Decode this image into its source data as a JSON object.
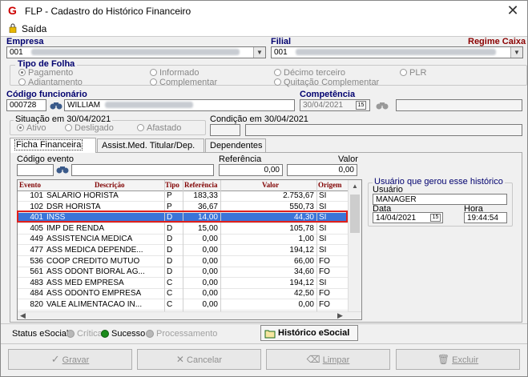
{
  "window": {
    "title": "FLP - Cadastro do Histórico Financeiro",
    "close_glyph": "✕"
  },
  "menu": {
    "saida": "Saída"
  },
  "empresa": {
    "label": "Empresa",
    "value": "001"
  },
  "filial": {
    "label": "Filial",
    "value": "001"
  },
  "regime": {
    "label": "Regime Caixa"
  },
  "tipo_folha": {
    "label": "Tipo de Folha",
    "options": [
      "Pagamento",
      "Informado",
      "Décimo terceiro",
      "PLR",
      "Adiantamento",
      "Complementar",
      "Quitação Complementar"
    ],
    "selected": "Pagamento"
  },
  "funcionario": {
    "label": "Código funcionário",
    "code": "000728",
    "name": "WILLIAM"
  },
  "competencia": {
    "label": "Competência",
    "value": "30/04/2021",
    "calendar_text": "15"
  },
  "situacao": {
    "label": "Situação em 30/04/2021",
    "options": [
      "Ativo",
      "Desligado",
      "Afastado"
    ],
    "selected": "Ativo"
  },
  "condicao": {
    "label": "Condição em 30/04/2021"
  },
  "tabs": [
    "Ficha Financeira",
    "Assist.Med. Titular/Dep.",
    "Dependentes"
  ],
  "evento_form": {
    "codigo_label": "Código evento",
    "referencia_label": "Referência",
    "referencia_value": "0,00",
    "valor_label": "Valor",
    "valor_value": "0,00"
  },
  "grid": {
    "columns": [
      "Evento",
      "Descrição",
      "Tipo",
      "Referência",
      "Valor",
      "Origem"
    ],
    "rows": [
      {
        "evento": "101",
        "descricao": "SALARIO HORISTA",
        "tipo": "P",
        "referencia": "183,33",
        "valor": "2.753,67",
        "origem": "SI"
      },
      {
        "evento": "102",
        "descricao": "DSR HORISTA",
        "tipo": "P",
        "referencia": "36,67",
        "valor": "550,73",
        "origem": "SI"
      },
      {
        "evento": "401",
        "descricao": "INSS",
        "tipo": "D",
        "referencia": "14,00",
        "valor": "44,30",
        "origem": "SI"
      },
      {
        "evento": "405",
        "descricao": "IMP DE RENDA",
        "tipo": "D",
        "referencia": "15,00",
        "valor": "105,78",
        "origem": "SI"
      },
      {
        "evento": "449",
        "descricao": "ASSISTENCIA MEDICA",
        "tipo": "D",
        "referencia": "0,00",
        "valor": "1,00",
        "origem": "SI"
      },
      {
        "evento": "477",
        "descricao": "ASS MEDICA DEPENDE...",
        "tipo": "D",
        "referencia": "0,00",
        "valor": "194,12",
        "origem": "SI"
      },
      {
        "evento": "536",
        "descricao": "COOP CREDITO MUTUO",
        "tipo": "D",
        "referencia": "0,00",
        "valor": "66,00",
        "origem": "FO"
      },
      {
        "evento": "561",
        "descricao": "ASS ODONT BIORAL AG...",
        "tipo": "D",
        "referencia": "0,00",
        "valor": "34,60",
        "origem": "FO"
      },
      {
        "evento": "483",
        "descricao": "ASS MED EMPRESA",
        "tipo": "C",
        "referencia": "0,00",
        "valor": "194,12",
        "origem": "SI"
      },
      {
        "evento": "484",
        "descricao": "ASS ODONTO EMPRESA",
        "tipo": "C",
        "referencia": "0,00",
        "valor": "42,50",
        "origem": "FO"
      },
      {
        "evento": "820",
        "descricao": "VALE ALIMENTACAO IN...",
        "tipo": "C",
        "referencia": "0,00",
        "valor": "0,00",
        "origem": "FO"
      }
    ]
  },
  "usuario_group": {
    "title": "Usuário que gerou esse histórico",
    "usuario_label": "Usuário",
    "usuario_value": "MANAGER",
    "data_label": "Data",
    "data_value": "14/04/2021",
    "hora_label": "Hora",
    "hora_value": "19:44:54"
  },
  "status": {
    "label": "Status eSocial:",
    "critica": "Crítica",
    "sucesso": "Sucesso",
    "processamento": "Processamento",
    "historico": "Histórico eSocial",
    "colors": {
      "critica": "#b0b0b0",
      "sucesso": "#1a8a1a",
      "processamento": "#b0b0b0"
    }
  },
  "buttons": {
    "gravar": "Gravar",
    "cancelar": "Cancelar",
    "limpar": "Limpar",
    "excluir": "Excluir"
  },
  "colors": {
    "selected_row": "#3a74d8",
    "highlight_border": "#e0201c",
    "label_blue": "#00006f",
    "label_red": "#8b0000"
  }
}
